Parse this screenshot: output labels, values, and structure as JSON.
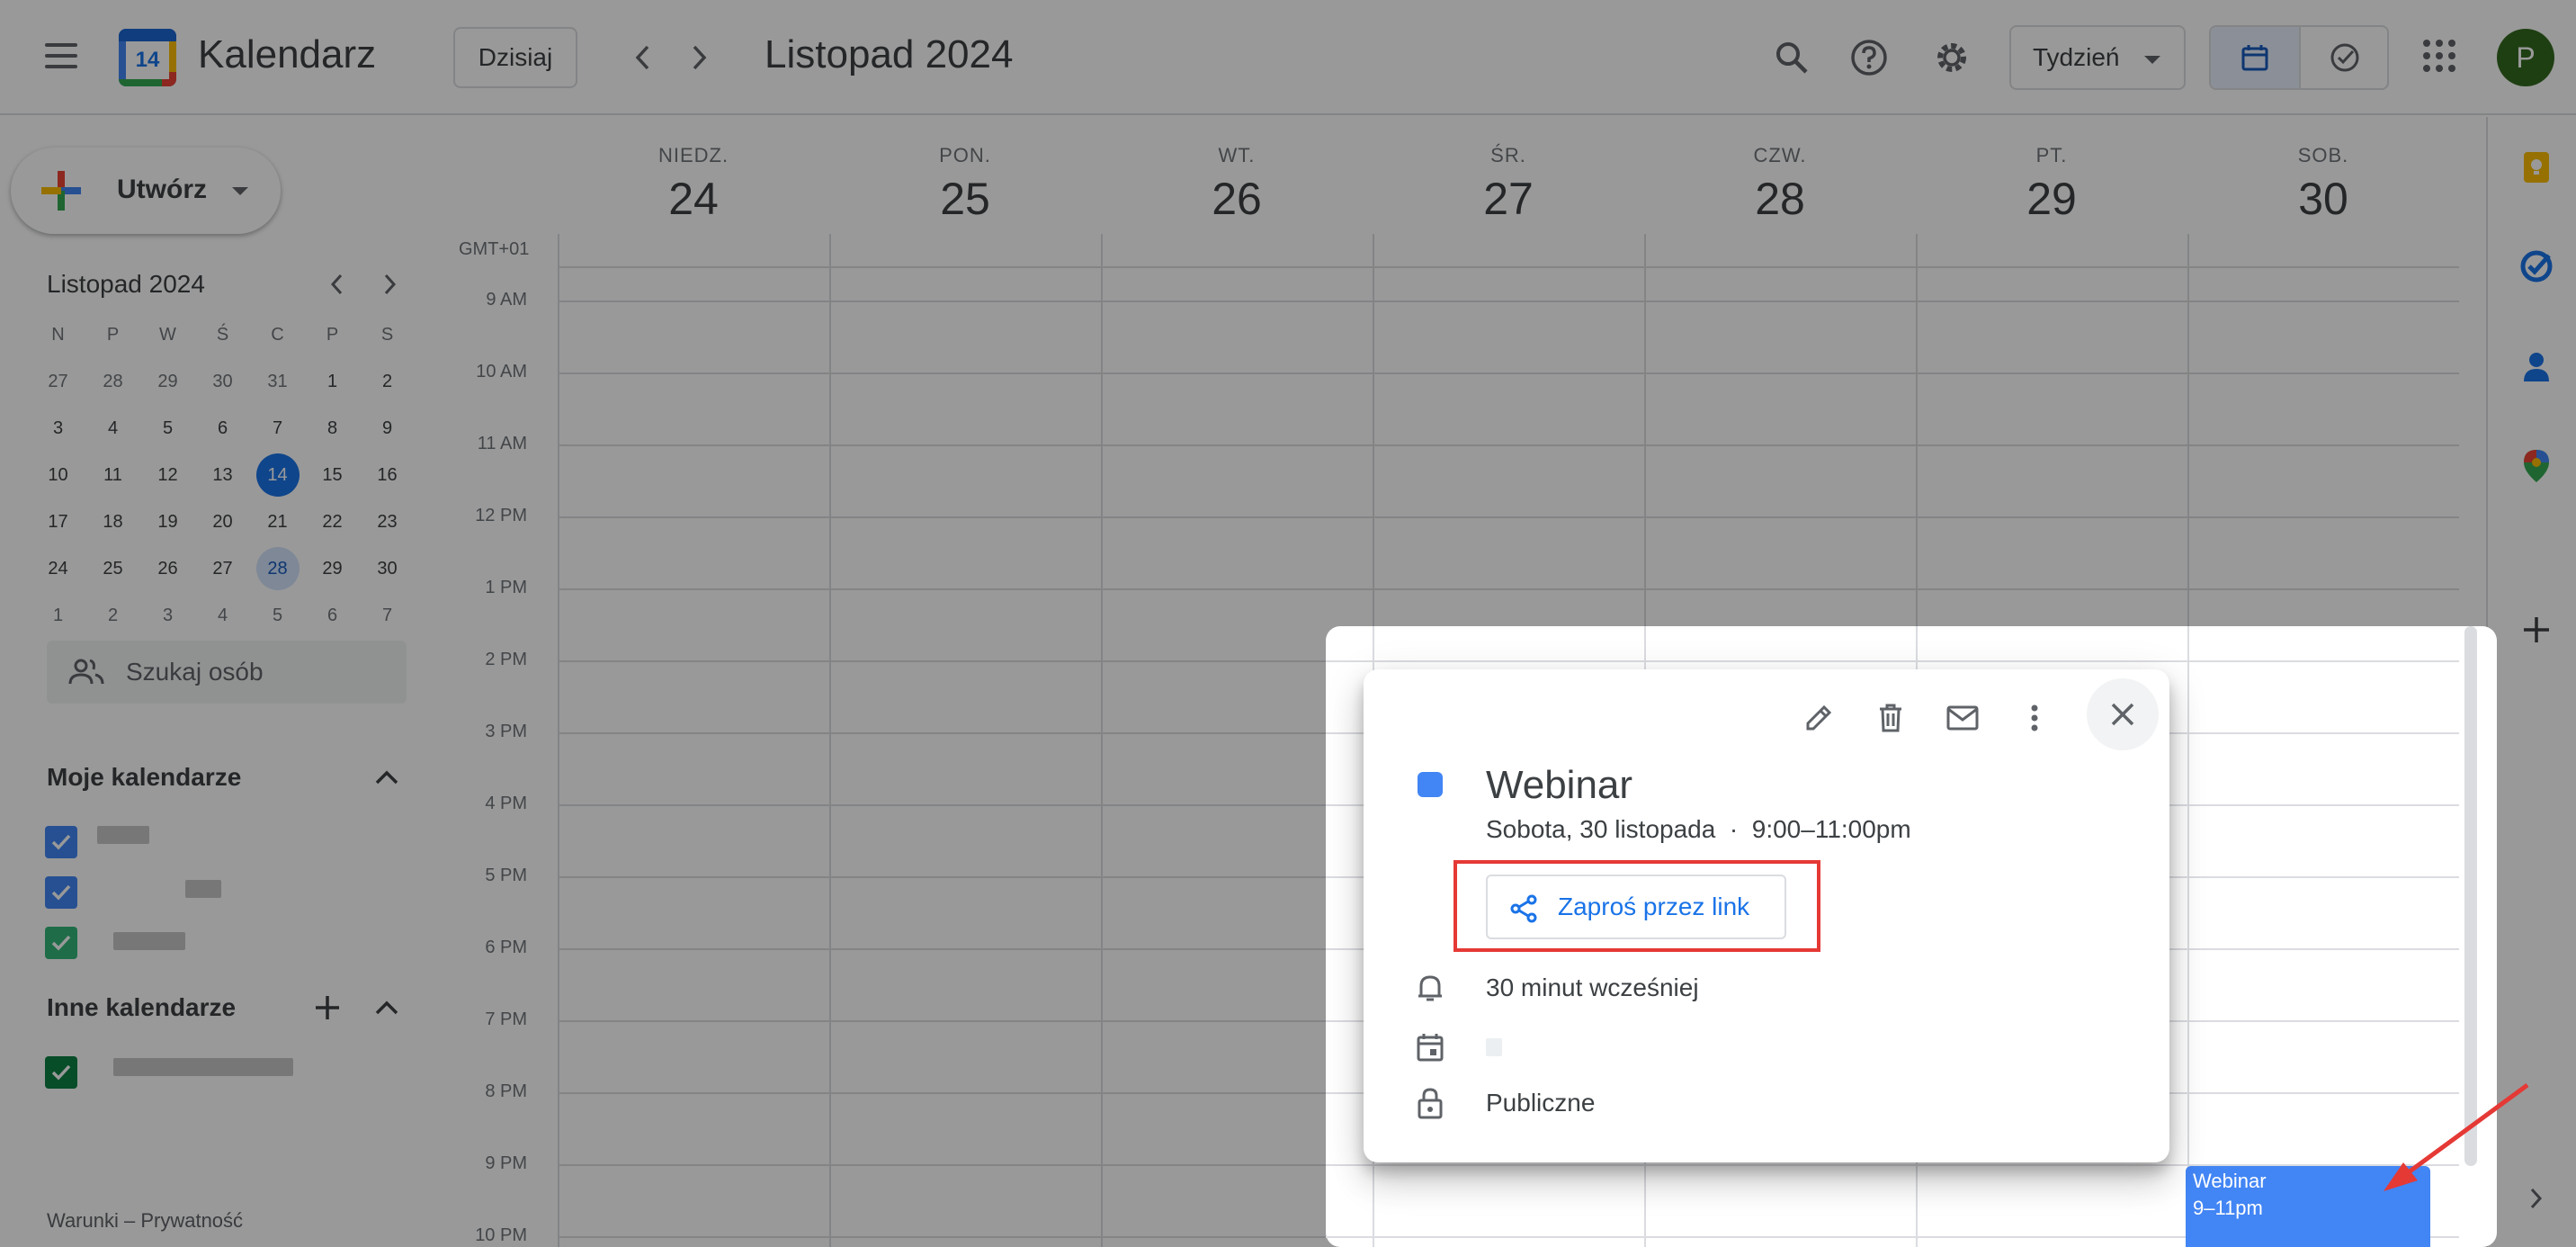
{
  "header": {
    "app_title": "Kalendarz",
    "logo_day": "14",
    "today_label": "Dzisiaj",
    "period_title": "Listopad 2024",
    "view_label": "Tydzień",
    "avatar_initial": "P"
  },
  "sidebar": {
    "create_label": "Utwórz",
    "mini_title": "Listopad 2024",
    "weekday_heads": [
      "N",
      "P",
      "W",
      "Ś",
      "C",
      "P",
      "S"
    ],
    "weeks": [
      [
        "27",
        "28",
        "29",
        "30",
        "31",
        "1",
        "2"
      ],
      [
        "3",
        "4",
        "5",
        "6",
        "7",
        "8",
        "9"
      ],
      [
        "10",
        "11",
        "12",
        "13",
        "14",
        "15",
        "16"
      ],
      [
        "17",
        "18",
        "19",
        "20",
        "21",
        "22",
        "23"
      ],
      [
        "24",
        "25",
        "26",
        "27",
        "28",
        "29",
        "30"
      ],
      [
        "1",
        "2",
        "3",
        "4",
        "5",
        "6",
        "7"
      ]
    ],
    "search_people": "Szukaj osób",
    "my_calendars_title": "Moje kalendarze",
    "other_calendars_title": "Inne kalendarze",
    "footer": "Warunki – Prywatność"
  },
  "week": {
    "days": [
      {
        "name": "NIEDZ.",
        "num": "24"
      },
      {
        "name": "PON.",
        "num": "25"
      },
      {
        "name": "WT.",
        "num": "26"
      },
      {
        "name": "ŚR.",
        "num": "27"
      },
      {
        "name": "CZW.",
        "num": "28"
      },
      {
        "name": "PT.",
        "num": "29"
      },
      {
        "name": "SOB.",
        "num": "30"
      }
    ],
    "timezone": "GMT+01",
    "hours": [
      "9 AM",
      "10 AM",
      "11 AM",
      "12 PM",
      "1 PM",
      "2 PM",
      "3 PM",
      "4 PM",
      "5 PM",
      "6 PM",
      "7 PM",
      "8 PM",
      "9 PM",
      "10 PM"
    ]
  },
  "event_chip": {
    "title": "Webinar",
    "time": "9–11pm"
  },
  "popup": {
    "title": "Webinar",
    "date_line": "Sobota, 30 listopada  ·  9:00–11:00pm",
    "invite_label": "Zaproś przez link",
    "reminder": "30 minut wcześniej",
    "visibility": "Publiczne"
  },
  "colors": {
    "accent": "#1a73e8",
    "event": "#4285f4",
    "highlight": "#e53935",
    "avatar": "#33691e"
  }
}
